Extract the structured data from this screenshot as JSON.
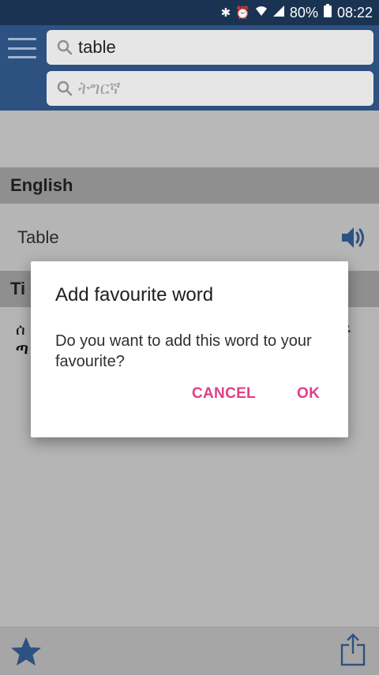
{
  "status_bar": {
    "icons": [
      "bluetooth-icon",
      "alarm-icon",
      "wifi-icon",
      "signal-icon"
    ],
    "battery": "80%",
    "time": "08:22"
  },
  "search": {
    "english_value": "table",
    "amharic_placeholder": "ትግርኛ"
  },
  "sections": {
    "english_header": "English",
    "result_word": "Table",
    "tigrinya_header_partial": "Ti",
    "tigrinya_text_line1": "ሰ",
    "tigrinya_text_line2": "ጣ",
    "tigrinya_text_right": "ፍ"
  },
  "dialog": {
    "title": "Add favourite word",
    "message": "Do you want to add this word to your favourite?",
    "cancel_label": "CANCEL",
    "ok_label": "OK"
  },
  "colors": {
    "appbar": "#2d5180",
    "statusbar": "#1b3352",
    "accent": "#e23d86",
    "speaker": "#2d5180"
  }
}
